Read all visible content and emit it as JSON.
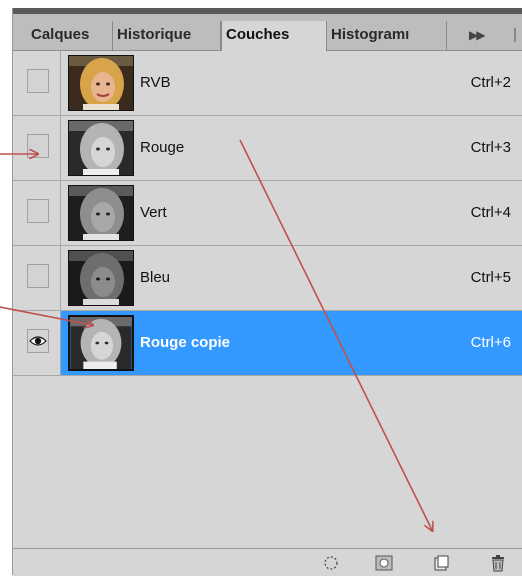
{
  "tabs": [
    {
      "label": "Calques"
    },
    {
      "label": "Historique"
    },
    {
      "label": "Couches",
      "active": true
    },
    {
      "label": "Histogramı"
    }
  ],
  "tab_menu_glyph": "▶▶",
  "tab_separator": "|",
  "channels": [
    {
      "name": "RVB",
      "shortcut": "Ctrl+2",
      "visible": false,
      "selected": false,
      "thumb": "color"
    },
    {
      "name": "Rouge",
      "shortcut": "Ctrl+3",
      "visible": false,
      "selected": false,
      "thumb": "gray"
    },
    {
      "name": "Vert",
      "shortcut": "Ctrl+4",
      "visible": false,
      "selected": false,
      "thumb": "gray"
    },
    {
      "name": "Bleu",
      "shortcut": "Ctrl+5",
      "visible": false,
      "selected": false,
      "thumb": "gray"
    },
    {
      "name": "Rouge copie",
      "shortcut": "Ctrl+6",
      "visible": true,
      "selected": true,
      "thumb": "gray"
    }
  ],
  "toolbar_icons": [
    "load-selection-icon",
    "save-selection-icon",
    "new-channel-icon",
    "trash-icon"
  ],
  "colors": {
    "selection": "#3399ff",
    "panel": "#d6d6d6",
    "annotation_arrow": "#c0504d"
  }
}
